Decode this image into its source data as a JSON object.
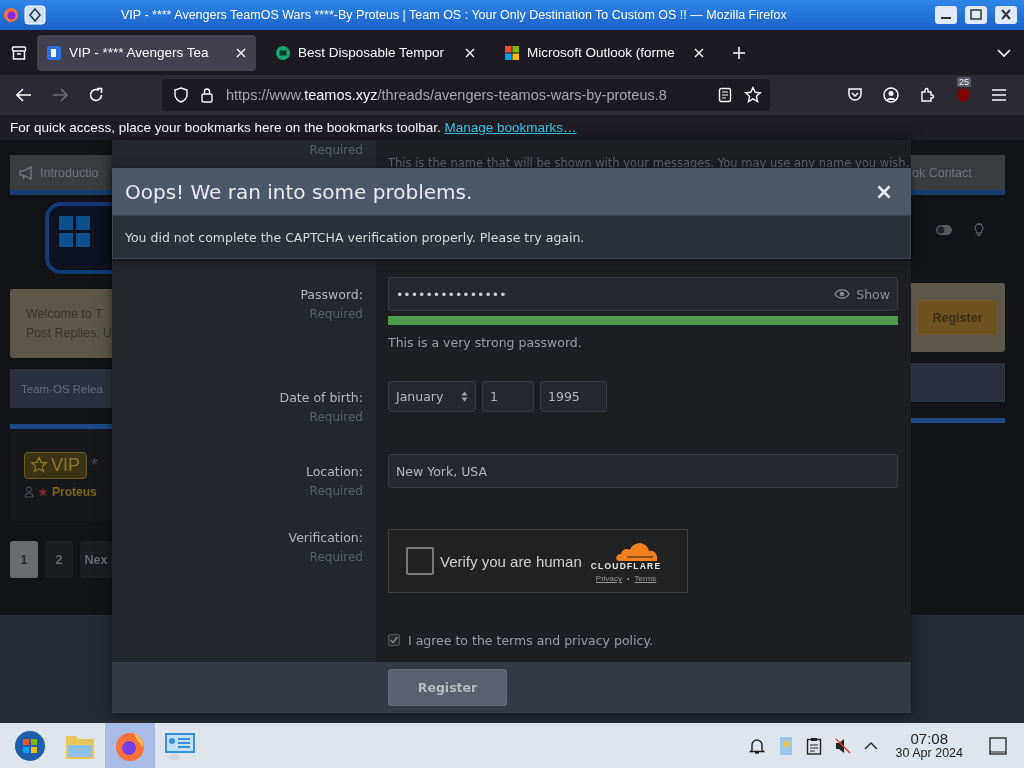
{
  "window": {
    "title": "VIP - **** Avengers TeamOS Wars ****-By Proteus | Team OS : Your Only Destination To Custom OS !! — Mozilla Firefox"
  },
  "tabs": [
    {
      "label": "VIP - **** Avengers Tea",
      "selected": true,
      "kind": "site"
    },
    {
      "label": "Best Disposable Tempor",
      "selected": false,
      "kind": "mail"
    },
    {
      "label": "Microsoft Outlook (forme",
      "selected": false,
      "kind": "windows"
    }
  ],
  "address_bar": {
    "url": "https://www.**teamos.xyz**/threads/avengers-teamos-wars-by-proteus.8"
  },
  "toolbar": {
    "extension_badge": "25"
  },
  "bookmarks_bar": {
    "message": "For quick access, place your bookmarks here on the bookmarks toolbar.",
    "link": "Manage bookmarks…"
  },
  "page_behind": {
    "left": {
      "nav_item": "Introductio",
      "welcome": [
        "Welcome to T",
        "Post Replies, U"
      ],
      "section": "Team-OS Relea",
      "badge": "VIP",
      "title_fragment": "*",
      "author": "Proteus",
      "pages": [
        {
          "label": "1",
          "selected": true
        },
        {
          "label": "2",
          "selected": false
        },
        {
          "label": "Nex",
          "selected": false
        }
      ]
    },
    "right": {
      "nav_item": "ok Contact",
      "register": "Register"
    }
  },
  "modal": {
    "partial_row": {
      "hint": "Required",
      "explain": "This is the name that will be shown with your messages. You may use any name you wish."
    },
    "error": {
      "title": "Oops! We ran into some problems.",
      "message": "You did not complete the CAPTCHA verification properly. Please try again."
    },
    "fields": [
      {
        "kind": "password",
        "label": "Password:",
        "hint": "Required",
        "value": "•••••••••••••••",
        "show_label": "Show",
        "level": 1,
        "strength_text": "This is a very strong password."
      },
      {
        "kind": "date",
        "label": "Date of birth:",
        "hint": "Required",
        "month": "January",
        "day": "1",
        "year": "1995"
      },
      {
        "kind": "text",
        "label": "Location:",
        "hint": "Required",
        "value": "New York, USA"
      },
      {
        "kind": "captcha",
        "label": "Verification:",
        "hint": "Required",
        "checked": false,
        "text": "Verify you are human",
        "brand": "CLOUDFLARE",
        "links": [
          "Privacy",
          "Terms"
        ],
        "separator": "•"
      }
    ],
    "agree": {
      "checked": true,
      "label": "I agree to the terms and privacy policy."
    },
    "submit": "Register"
  },
  "taskbar": {
    "apps": [
      {
        "kind": "start",
        "selected": false
      },
      {
        "kind": "files",
        "selected": false
      },
      {
        "kind": "firefox",
        "selected": true
      },
      {
        "kind": "network",
        "selected": false
      }
    ],
    "speaker_muted": true,
    "clock": {
      "time": "07:08",
      "date": "30 Apr 2024"
    }
  }
}
